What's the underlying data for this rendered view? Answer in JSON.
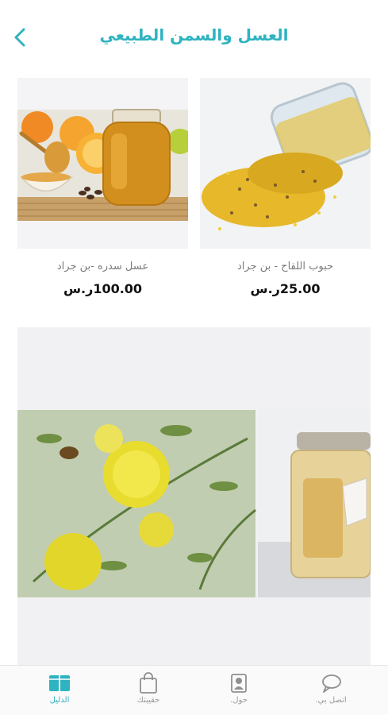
{
  "header": {
    "title": "العسل والسمن الطبيعي",
    "back_icon": "chevron-left-icon",
    "accent_color": "#2fb3c0"
  },
  "products": [
    {
      "name": "حبوب اللقاح - بن جراد",
      "price": "25.00ر.س"
    },
    {
      "name": "عسل سدره -بن جراد",
      "price": "100.00ر.س"
    }
  ],
  "bottom_nav": [
    {
      "label": "الدليل",
      "icon": "book-icon",
      "active": true
    },
    {
      "label": "حقيبتك",
      "icon": "shopping-bag-icon",
      "active": false
    },
    {
      "label": "حول.",
      "icon": "profile-icon",
      "active": false
    },
    {
      "label": "اتصل بي.",
      "icon": "chat-bubble-icon",
      "active": false
    }
  ]
}
